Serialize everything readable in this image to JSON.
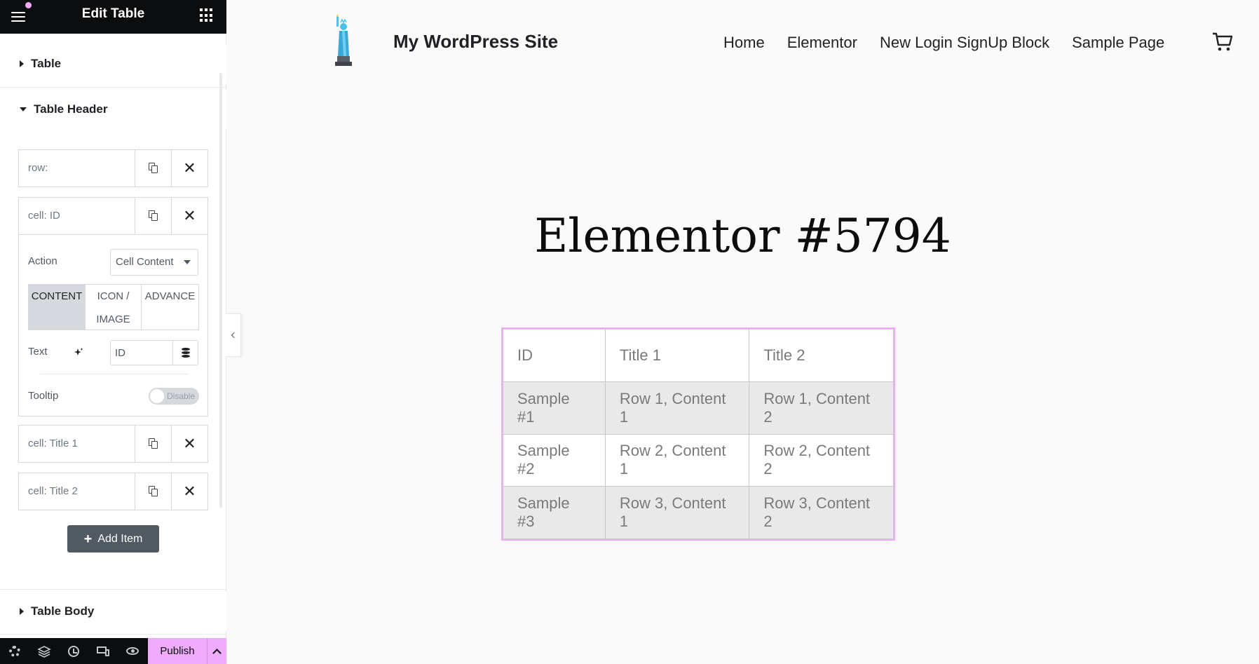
{
  "panel": {
    "title": "Edit Table",
    "sections": {
      "table": "Table",
      "table_header": "Table Header",
      "table_body": "Table Body"
    },
    "repeater_items": [
      {
        "title": "row:"
      },
      {
        "title": "cell: ID"
      },
      {
        "title": "cell: Title 1"
      },
      {
        "title": "cell: Title 2"
      }
    ],
    "expanded_item": {
      "action_label": "Action",
      "action_value": "Cell Content",
      "tabs": [
        {
          "label": "CONTENT",
          "active": true
        },
        {
          "label": "ICON / IMAGE",
          "active": false
        },
        {
          "label": "ADVANCE",
          "active": false
        }
      ],
      "text_label": "Text",
      "text_value": "ID",
      "tooltip_label": "Tooltip",
      "tooltip_state": "Disable"
    },
    "add_item_label": "Add Item",
    "publish_label": "Publish",
    "accent_color": "#f0abfc"
  },
  "site": {
    "title": "My WordPress Site",
    "nav": [
      "Home",
      "Elementor",
      "New Login SignUp Block",
      "Sample Page"
    ],
    "page_heading": "Elementor #5794"
  },
  "table": {
    "headers": [
      "ID",
      "Title 1",
      "Title 2"
    ],
    "rows": [
      [
        "Sample #1",
        "Row 1, Content 1",
        "Row 1, Content 2"
      ],
      [
        "Sample #2",
        "Row 2, Content 1",
        "Row 2, Content 2"
      ],
      [
        "Sample #3",
        "Row 3, Content 1",
        "Row 3, Content 2"
      ]
    ]
  }
}
